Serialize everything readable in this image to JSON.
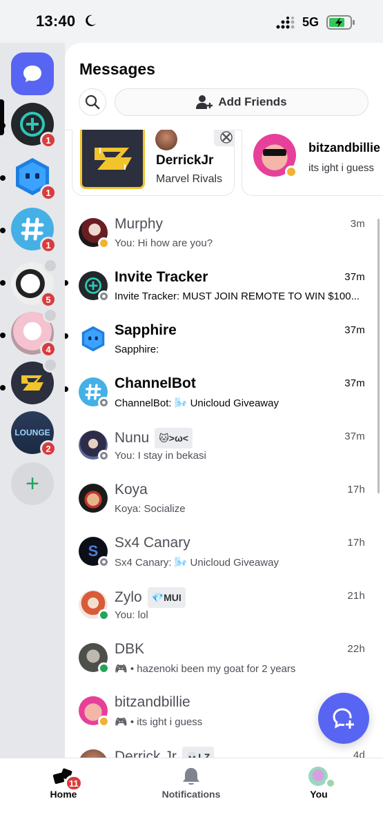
{
  "status_bar": {
    "time": "13:40",
    "network": "5G"
  },
  "rail": {
    "badges": [
      "1",
      "1",
      "1",
      "5",
      "4",
      "2"
    ],
    "lounge_label": "LOUNGE"
  },
  "header": {
    "title": "Messages",
    "add_friends_label": "Add Friends"
  },
  "activity_cards": [
    {
      "name": "DerrickJr",
      "game": "Marvel Rivals"
    },
    {
      "name": "bitzandbillie",
      "status": "its ight i guess"
    }
  ],
  "dms": [
    {
      "name": "Murphy",
      "preview": "You: Hi how are you?",
      "time": "3m",
      "unread": false,
      "status": "idle"
    },
    {
      "name": "Invite Tracker",
      "preview": "Invite Tracker: MUST JOIN REMOTE TO WIN $100...",
      "time": "37m",
      "unread": true,
      "status": "offline"
    },
    {
      "name": "Sapphire",
      "preview": "Sapphire:",
      "time": "37m",
      "unread": true,
      "status": "none"
    },
    {
      "name": "ChannelBot",
      "preview": "ChannelBot: 🌬️ Unicloud Giveaway",
      "time": "37m",
      "unread": true,
      "status": "offline"
    },
    {
      "name": "Nunu",
      "tag": "🐱>ω<",
      "preview": "You: I stay in bekasi",
      "time": "37m",
      "unread": false,
      "status": "offline"
    },
    {
      "name": "Koya",
      "preview": "Koya: Socialize",
      "time": "17h",
      "unread": false,
      "status": "none"
    },
    {
      "name": "Sx4 Canary",
      "preview": "Sx4 Canary: 🌬️ Unicloud Giveaway",
      "time": "17h",
      "unread": false,
      "status": "offline"
    },
    {
      "name": "Zylo",
      "tag": "💎MUI",
      "preview": "You: lol",
      "time": "21h",
      "unread": false,
      "status": "online"
    },
    {
      "name": "DBK",
      "preview": "🎮 • hazenoki been my goat for 2 years",
      "time": "22h",
      "unread": false,
      "status": "online"
    },
    {
      "name": "bitzandbillie",
      "preview": "🎮 • its ight i guess",
      "time": "",
      "unread": false,
      "status": "idle"
    },
    {
      "name": "Derrick Jr",
      "tag": "💀LZ",
      "preview": "",
      "time": "4d",
      "unread": false,
      "status": "none"
    }
  ],
  "bottom_nav": {
    "home_label": "Home",
    "home_badge": "11",
    "notifications_label": "Notifications",
    "you_label": "You"
  },
  "colors": {
    "brand": "#5865f2",
    "mention_red": "#d83c3e",
    "online": "#23a559",
    "idle": "#f0b232"
  }
}
